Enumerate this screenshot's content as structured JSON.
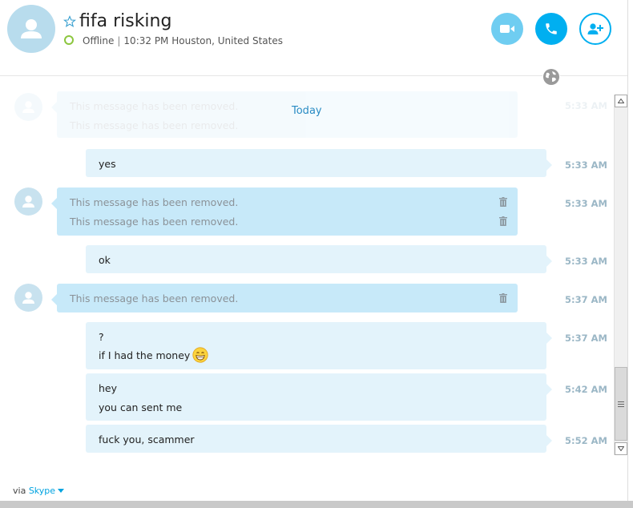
{
  "header": {
    "contact_name": "fifa risking",
    "status": "Offline",
    "local_time": "10:32 PM Houston, United States",
    "colors": {
      "accent": "#00aff0",
      "video_button": "#6fcdf1",
      "online_ring": "#8cc63e"
    }
  },
  "icons": {
    "favorite": "star-outline-icon",
    "video": "video-camera-icon",
    "call": "phone-icon",
    "add": "add-person-icon",
    "globe": "globe-icon",
    "delete": "trash-icon",
    "avatar": "person-icon"
  },
  "chat": {
    "day_divider": "Today",
    "faded_messages": [
      "This message has been removed.",
      "This message has been removed."
    ],
    "faded_time": "5:33 AM",
    "messages": [
      {
        "dir": "out",
        "lines": [
          "yes"
        ],
        "time": "5:33 AM"
      },
      {
        "dir": "in",
        "lines": [
          "This message has been removed.",
          "This message has been removed."
        ],
        "time": "5:33 AM"
      },
      {
        "dir": "out",
        "lines": [
          "ok"
        ],
        "time": "5:33 AM"
      },
      {
        "dir": "in",
        "lines": [
          "This message has been removed."
        ],
        "time": "5:37 AM"
      },
      {
        "dir": "out",
        "lines": [
          "?",
          "if I had the money"
        ],
        "time": "5:37 AM"
      },
      {
        "dir": "out",
        "lines": [
          "hey",
          "you can sent me"
        ],
        "time": "5:42 AM"
      },
      {
        "dir": "out",
        "lines": [
          "fuck you, scammer"
        ],
        "time": "5:52 AM"
      }
    ]
  },
  "footer": {
    "via": "via",
    "service": "Skype"
  }
}
